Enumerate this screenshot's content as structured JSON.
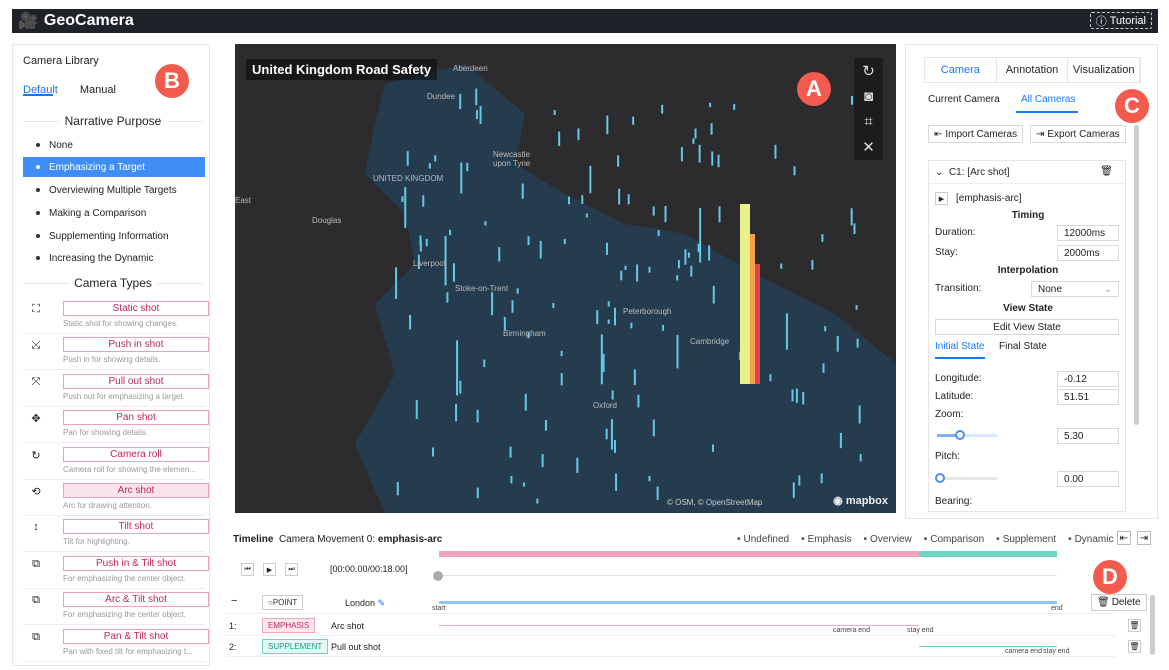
{
  "app": {
    "title": "GeoCamera",
    "tutorial": "Tutorial"
  },
  "library": {
    "title": "Camera Library",
    "tabs": [
      "Default",
      "Manual"
    ],
    "purpose_header": "Narrative Purpose",
    "purposes": [
      "None",
      "Emphasizing a Target",
      "Overviewing Multiple Targets",
      "Making a Comparison",
      "Supplementing Information",
      "Increasing the Dynamic"
    ],
    "types_header": "Camera Types",
    "types": [
      {
        "label": "Static shot",
        "desc": "Static shot for showing changes.",
        "icon": "⛶"
      },
      {
        "label": "Push in shot",
        "desc": "Push in for showing details.",
        "icon": "⤩"
      },
      {
        "label": "Pull out shot",
        "desc": "Push out for emphasizing a target.",
        "icon": "⤧"
      },
      {
        "label": "Pan shot",
        "desc": "Pan for showing details.",
        "icon": "✥"
      },
      {
        "label": "Camera roll",
        "desc": "Camera roll for showing the elemen...",
        "icon": "↻"
      },
      {
        "label": "Arc shot",
        "desc": "Arc for drawing attention.",
        "icon": "⟲"
      },
      {
        "label": "Tilt shot",
        "desc": "Tilt for highlighting.",
        "icon": "↕"
      },
      {
        "label": "Push in & Tilt shot",
        "desc": "For emphasizing the center object.",
        "icon": "⧉"
      },
      {
        "label": "Arc & Tilt shot",
        "desc": "For emphasizing the center object.",
        "icon": "⧉"
      },
      {
        "label": "Pan & Tilt shot",
        "desc": "Pan with fixed tilt for emphasizing t...",
        "icon": "⧉"
      }
    ]
  },
  "map": {
    "title": "United Kingdom Road Safety",
    "brand": "mapbox",
    "attrib": "© OSM, © OpenStreetMap",
    "labels": [
      "Aberdeen",
      "Dundee",
      "Newcastle upon Tyne",
      "UNITED KINGDOM",
      "Douglas",
      "Liverpool",
      "Stoke-on-Trent",
      "Peterborough",
      "Oxford",
      "Cambridge",
      "Birmingham",
      "East"
    ]
  },
  "camera": {
    "tabs": [
      "Camera",
      "Annotation",
      "Visualization"
    ],
    "subtabs": [
      "Current Camera",
      "All Cameras"
    ],
    "import": "Import Cameras",
    "export": "Export Cameras",
    "card_title": "C1: [Arc shot]",
    "preset": "[emphasis-arc]",
    "timing": "Timing",
    "duration_label": "Duration:",
    "duration": "12000ms",
    "stay_label": "Stay:",
    "stay": "2000ms",
    "interp": "Interpolation",
    "transition_label": "Transition:",
    "transition": "None",
    "viewstate": "View State",
    "edit": "Edit View State",
    "state_tabs": [
      "Initial State",
      "Final State"
    ],
    "lon_label": "Longitude:",
    "lon": "-0.12",
    "lat_label": "Latitude:",
    "lat": "51.51",
    "zoom_label": "Zoom:",
    "zoom": "5.30",
    "pitch_label": "Pitch:",
    "pitch": "0.00",
    "bearing_label": "Bearing:"
  },
  "timeline": {
    "title": "Timeline",
    "movement": "Camera Movement 0:",
    "movement_name": "emphasis-arc",
    "legend": [
      "Undefined",
      "Emphasis",
      "Overview",
      "Comparison",
      "Supplement",
      "Dynamic"
    ],
    "time": "[00:00.00/00:18.00]",
    "point_tag": "POINT",
    "point_name": "London",
    "start": "start",
    "end": "end",
    "delete": "Delete",
    "rows": [
      {
        "idx": "1:",
        "tag": "EMPHASIS",
        "name": "Arc shot",
        "cam_end": "camera end",
        "stay_end": "stay end"
      },
      {
        "idx": "2:",
        "tag": "SUPPLEMENT",
        "name": "Pull out shot",
        "cam_end": "camera end",
        "stay_end": "stay end"
      }
    ]
  },
  "markers": [
    "A",
    "B",
    "C",
    "D"
  ],
  "colors": {
    "emphasis": "#f0a5bf",
    "supplement": "#6fd6c5",
    "accent": "#1677ff"
  }
}
